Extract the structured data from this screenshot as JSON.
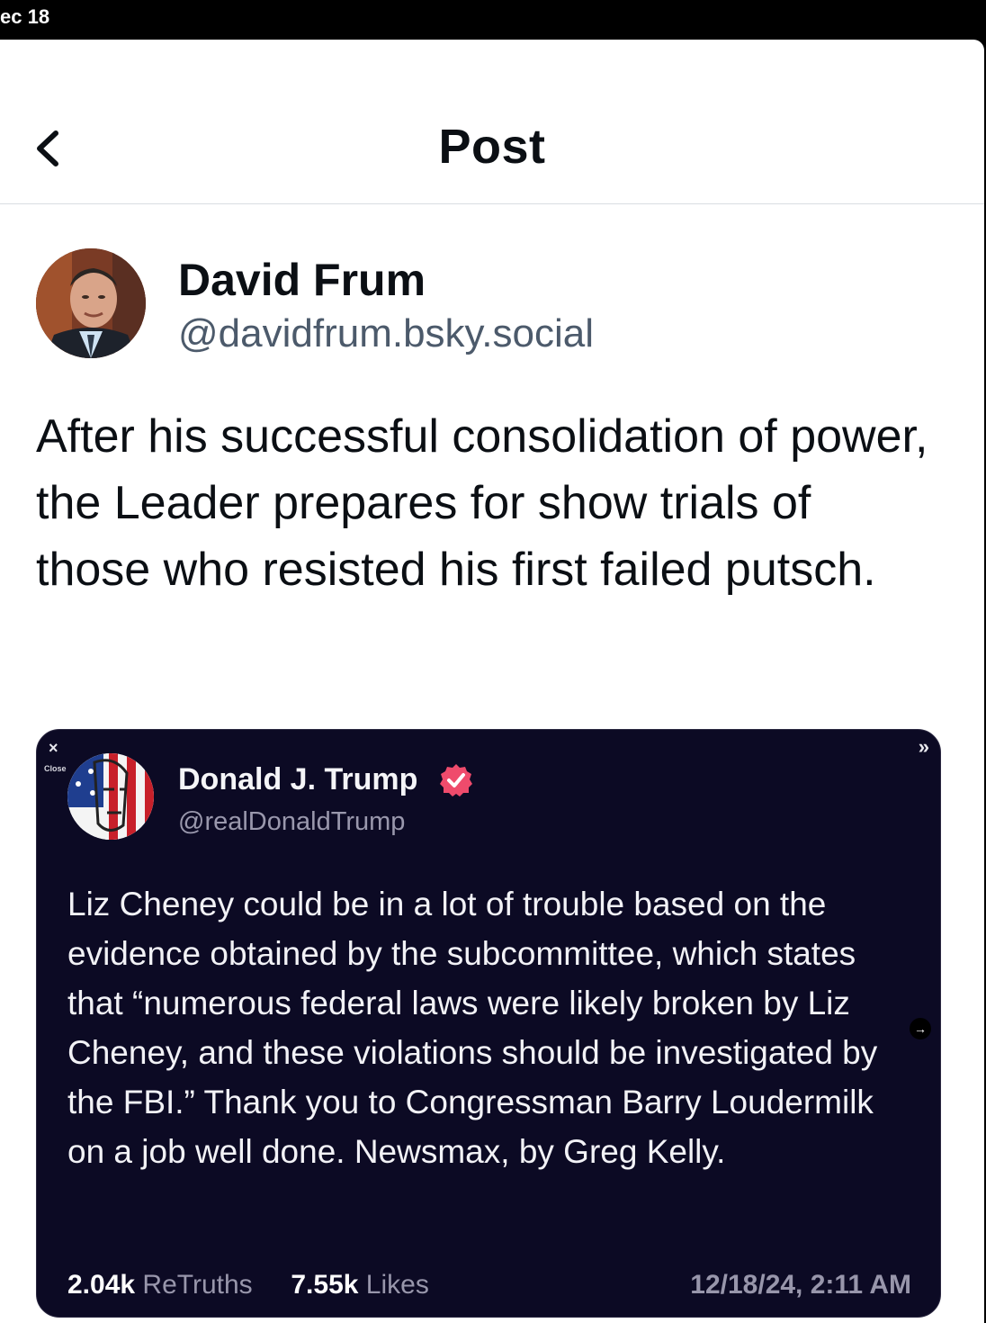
{
  "status_bar": {
    "time": "ec 18"
  },
  "header": {
    "title": "Post",
    "back_icon": "chevron-left-icon"
  },
  "post": {
    "author_name": "David Frum",
    "author_handle": "@davidfrum.bsky.social",
    "text": "After his successful consolidation of power, the Leader prepares for show trials of those who resisted his first failed putsch."
  },
  "embed": {
    "close_glyph": "×",
    "close_label": "Close",
    "more_glyph": "»",
    "arrow_glyph": "→",
    "author_name": "Donald J. Trump",
    "author_handle": "@realDonaldTrump",
    "verified_color": "#ef4b6c",
    "text": "Liz Cheney could be in a lot of trouble based on the evidence obtained by the subcommittee, which states that “numerous federal laws were likely broken by Liz Cheney, and these violations should be investigated by the FBI.” Thank you to Congressman Barry Loudermilk on a job well done. Newsmax, by Greg Kelly.",
    "retruths_count": "2.04k",
    "retruths_label": "ReTruths",
    "likes_count": "7.55k",
    "likes_label": "Likes",
    "timestamp": "12/18/24, 2:11 AM"
  }
}
